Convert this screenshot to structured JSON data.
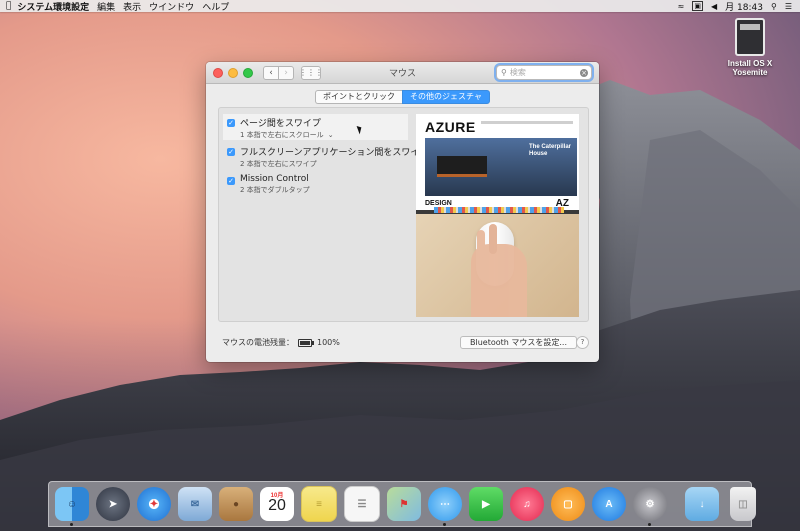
{
  "menubar": {
    "app_name": "システム環境設定",
    "menus": [
      "編集",
      "表示",
      "ウインドウ",
      "ヘルプ"
    ],
    "clock": "月 18:43"
  },
  "desktop": {
    "drive_label": "Install OS X\nYosemite"
  },
  "window": {
    "title": "マウス",
    "search_placeholder": "検索",
    "tabs": [
      {
        "label": "ポイントとクリック",
        "active": false
      },
      {
        "label": "その他のジェスチャ",
        "active": true
      }
    ],
    "gestures": [
      {
        "title": "ページ間をスワイプ",
        "subtitle": "1 本指で左右にスクロール",
        "checked": true,
        "selected": true,
        "has_dropdown": true
      },
      {
        "title": "フルスクリーンアプリケーション間をスワイプ",
        "subtitle": "2 本指で左右にスワイプ",
        "checked": true,
        "selected": false,
        "has_dropdown": false
      },
      {
        "title": "Mission Control",
        "subtitle": "2 本指でダブルタップ",
        "checked": true,
        "selected": false,
        "has_dropdown": false
      }
    ],
    "preview": {
      "site_logo": "AZURE",
      "headline": "The Caterpillar House",
      "section": "DESIGN",
      "side_text": "AZ"
    },
    "battery_label": "マウスの電池残量：",
    "battery_level": "100%",
    "bluetooth_button": "Bluetooth マウスを設定...",
    "help": "?"
  },
  "dock": {
    "calendar_month": "10月",
    "calendar_day": "20",
    "apps": [
      {
        "name": "finder-icon",
        "color": "#3f9fe8"
      },
      {
        "name": "launchpad-icon",
        "color": "#4a4f5c"
      },
      {
        "name": "safari-icon",
        "color": "#4ba6f0"
      },
      {
        "name": "mail-icon",
        "color": "#8ab0d8"
      },
      {
        "name": "contacts-icon",
        "color": "#c79a62"
      },
      {
        "name": "calendar-icon",
        "color": "#ffffff"
      },
      {
        "name": "notes-icon",
        "color": "#f5e27a"
      },
      {
        "name": "reminders-icon",
        "color": "#f2f2f2"
      },
      {
        "name": "maps-icon",
        "color": "#a8d08d"
      },
      {
        "name": "messages-icon",
        "color": "#5fb7f3"
      },
      {
        "name": "facetime-icon",
        "color": "#3fc84c"
      },
      {
        "name": "itunes-icon",
        "color": "#f5476a"
      },
      {
        "name": "ibooks-icon",
        "color": "#f39c2b"
      },
      {
        "name": "app-store-icon",
        "color": "#3c95ee"
      },
      {
        "name": "system-preferences-icon",
        "color": "#8c8c92"
      }
    ]
  }
}
